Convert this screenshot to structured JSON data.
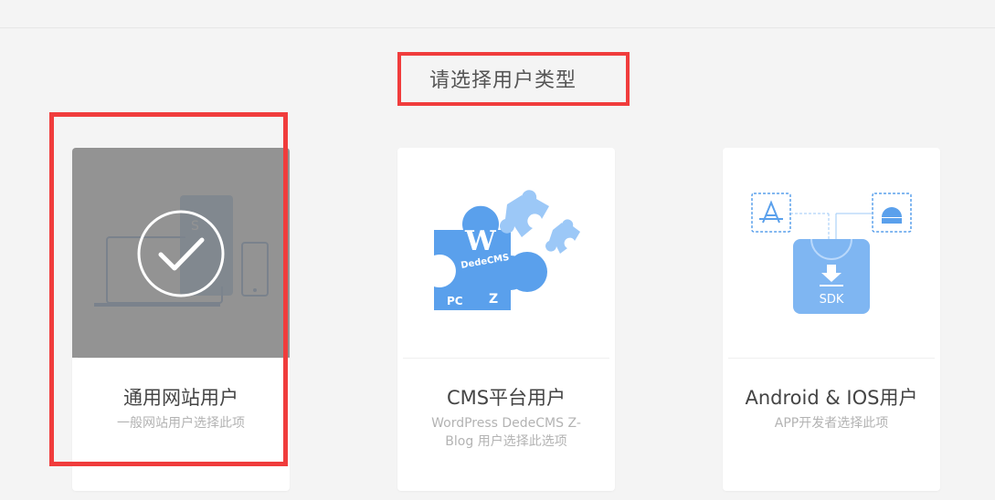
{
  "page": {
    "title": "请选择用户类型"
  },
  "cards": [
    {
      "name": "通用网站用户",
      "desc": "一般网站用户选择此项",
      "selected": true,
      "icon": "devices-icon"
    },
    {
      "name": "CMS平台用户",
      "desc": "WordPress DedeCMS Z- Blog 用户选择此选项",
      "selected": false,
      "icon": "cms-puzzle-icon",
      "puzzle_texts": [
        "W",
        "DedeCMS",
        "PC",
        "Z"
      ]
    },
    {
      "name": "Android & IOS用户",
      "desc": "APP开发者选择此项",
      "selected": false,
      "icon": "sdk-icon",
      "sdk_label": "SDK"
    }
  ],
  "colors": {
    "accent_blue": "#5aa0ec",
    "light_blue": "#9cc8f7",
    "highlight_red": "#f03c3c",
    "overlay_gray": "#808080"
  }
}
